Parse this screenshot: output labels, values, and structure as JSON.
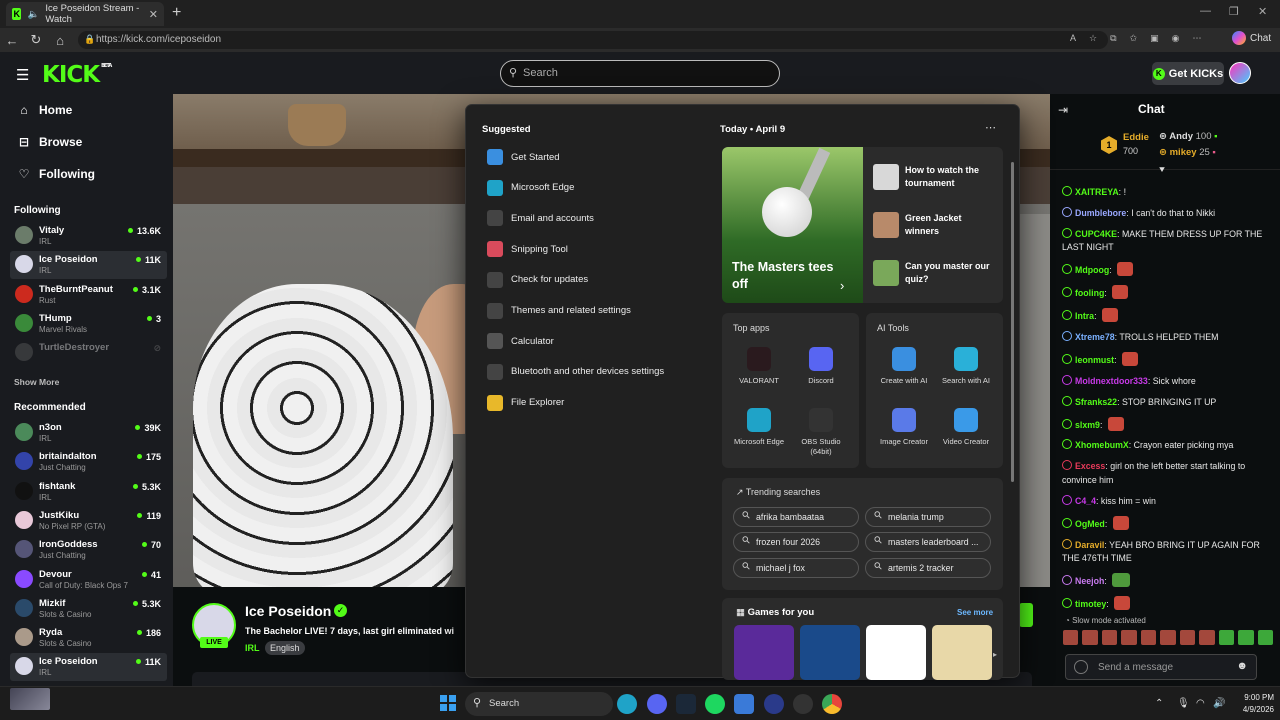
{
  "browser": {
    "tab_title": "Ice Poseidon Stream - Watch",
    "url": "https://kick.com/iceposeidon",
    "chat_label": "Chat"
  },
  "header": {
    "logo": "KICK",
    "logo_sup": "BETA",
    "search_placeholder": "Search",
    "get_kicks": "Get KICKs"
  },
  "sidebar": {
    "nav": [
      {
        "label": "Home",
        "icon": "home-icon"
      },
      {
        "label": "Browse",
        "icon": "browse-icon"
      },
      {
        "label": "Following",
        "icon": "heart-icon"
      }
    ],
    "following_title": "Following",
    "following": [
      {
        "name": "Vitaly",
        "category": "IRL",
        "viewers": "13.6K",
        "color": "#6b7c6a"
      },
      {
        "name": "Ice Poseidon",
        "category": "IRL",
        "viewers": "11K",
        "color": "#d8d8e8"
      },
      {
        "name": "TheBurntPeanut",
        "category": "Rust",
        "viewers": "3.1K",
        "color": "#cc2a1e"
      },
      {
        "name": "THump",
        "category": "Marvel Rivals",
        "viewers": "3",
        "color": "#3a8a3a"
      },
      {
        "name": "TurtleDestroyer",
        "category": "",
        "viewers": "",
        "color": "#666"
      }
    ],
    "show_more": "Show More",
    "recommended_title": "Recommended",
    "recommended": [
      {
        "name": "n3on",
        "category": "IRL",
        "viewers": "39K",
        "color": "#4b8a5a"
      },
      {
        "name": "britaindalton",
        "category": "Just Chatting",
        "viewers": "175",
        "color": "#3344aa"
      },
      {
        "name": "fishtank",
        "category": "IRL",
        "viewers": "5.3K",
        "color": "#111"
      },
      {
        "name": "JustKiku",
        "category": "No Pixel RP (GTA)",
        "viewers": "119",
        "color": "#e8c8d8"
      },
      {
        "name": "IronGoddess",
        "category": "Just Chatting",
        "viewers": "70",
        "color": "#555577"
      },
      {
        "name": "Devour",
        "category": "Call of Duty: Black Ops 7",
        "viewers": "41",
        "color": "#8a4aff"
      },
      {
        "name": "Mizkif",
        "category": "Slots & Casino",
        "viewers": "5.3K",
        "color": "#2a4a6a"
      },
      {
        "name": "Ryda",
        "category": "Slots & Casino",
        "viewers": "186",
        "color": "#aa9a8a"
      },
      {
        "name": "Ice Poseidon",
        "category": "IRL",
        "viewers": "11K",
        "color": "#d8d8e8"
      }
    ]
  },
  "stream": {
    "name": "Ice Poseidon",
    "live": "LIVE",
    "title": "The Bachelor LIVE! 7 days, last girl eliminated wi",
    "category": "IRL",
    "language": "English"
  },
  "start_menu": {
    "suggested_title": "Suggested",
    "suggested": [
      {
        "label": "Get Started",
        "icon": "get-started-icon",
        "color": "#3a8fe0"
      },
      {
        "label": "Microsoft Edge",
        "icon": "edge-icon",
        "color": "#1fa3c8"
      },
      {
        "label": "Email and accounts",
        "icon": "mail-icon",
        "color": "#444"
      },
      {
        "label": "Snipping Tool",
        "icon": "snipping-tool-icon",
        "color": "#d94b5c"
      },
      {
        "label": "Check for updates",
        "icon": "refresh-icon",
        "color": "#444"
      },
      {
        "label": "Themes and related settings",
        "icon": "brush-icon",
        "color": "#444"
      },
      {
        "label": "Calculator",
        "icon": "calculator-icon",
        "color": "#555"
      },
      {
        "label": "Bluetooth and other devices settings",
        "icon": "devices-icon",
        "color": "#444"
      },
      {
        "label": "File Explorer",
        "icon": "folder-icon",
        "color": "#e8b82a"
      }
    ],
    "today": "Today",
    "date": "April 9",
    "hero_title": "The Masters tees off",
    "news": [
      {
        "title": "How to watch the tournament",
        "color": "#d8d8d8"
      },
      {
        "title": "Green Jacket winners",
        "color": "#b88a6a"
      },
      {
        "title": "Can you master our quiz?",
        "color": "#7aa85a"
      }
    ],
    "top_apps_title": "Top apps",
    "top_apps": [
      {
        "label": "VALORANT",
        "icon": "valorant-icon",
        "color": "#2a1a1e"
      },
      {
        "label": "Discord",
        "icon": "discord-icon",
        "color": "#5865f2"
      },
      {
        "label": "Microsoft Edge",
        "icon": "edge-icon",
        "color": "#1fa3c8"
      },
      {
        "label": "OBS Studio (64bit)",
        "icon": "obs-icon",
        "color": "#333"
      }
    ],
    "ai_tools_title": "AI Tools",
    "ai_tools": [
      {
        "label": "Create with AI",
        "icon": "create-ai-icon",
        "color": "#3a8fe0"
      },
      {
        "label": "Search with AI",
        "icon": "search-ai-icon",
        "color": "#2ab0d8"
      },
      {
        "label": "Image Creator",
        "icon": "image-creator-icon",
        "color": "#5a7ae8"
      },
      {
        "label": "Video Creator",
        "icon": "video-creator-icon",
        "color": "#3a9ae8"
      }
    ],
    "trending_title": "Trending searches",
    "trending": [
      "afrika bambaataa",
      "melania trump",
      "frozen four 2026",
      "masters leaderboard ...",
      "michael j fox",
      "artemis 2 tracker"
    ],
    "games_title": "Games for you",
    "see_more": "See more",
    "games": [
      {
        "name": "arrow-game",
        "color": "#5a2a9a"
      },
      {
        "name": "drive-quest",
        "color": "#1a4a8a"
      },
      {
        "name": "cut-the-rope",
        "color": "#ffffff"
      },
      {
        "name": "cat-puzzle",
        "color": "#e8d8a8"
      }
    ]
  },
  "chat": {
    "title": "Chat",
    "leaderboard": [
      {
        "name": "Eddie",
        "amount": "700",
        "color": "#e5ac2a"
      },
      {
        "name": "Andy",
        "amount": "100",
        "color": "#dddddd"
      },
      {
        "name": "mikey",
        "amount": "25",
        "color": "#e5ac2a"
      }
    ],
    "messages": [
      {
        "user": "XAITREYA",
        "text": "!",
        "color": "#53fc18"
      },
      {
        "user": "Dumblebore",
        "text": "I can't do that to Nikki",
        "color": "#9aa8ff"
      },
      {
        "user": "CUPC4KE",
        "text": "MAKE THEM DRESS UP FOR THE LAST NIGHT",
        "color": "#53fc18"
      },
      {
        "user": "Mdpoog",
        "text": "",
        "color": "#53fc18"
      },
      {
        "user": "fooling",
        "text": "",
        "color": "#53fc18"
      },
      {
        "user": "Intra",
        "text": "",
        "color": "#53fc18"
      },
      {
        "user": "Xtreme78",
        "text": "TROLLS HELPED THEM",
        "color": "#7ab0ff"
      },
      {
        "user": "leonmust",
        "text": "",
        "color": "#53fc18"
      },
      {
        "user": "Moldnextdoor333",
        "text": "Sick whore",
        "color": "#c83ae8"
      },
      {
        "user": "Sfranks22",
        "text": "STOP BRINGING IT UP",
        "color": "#53fc18"
      },
      {
        "user": "slxm9",
        "text": "",
        "color": "#53fc18"
      },
      {
        "user": "XhomebumX",
        "text": "Crayon eater picking mya",
        "color": "#53fc18"
      },
      {
        "user": "Excess",
        "text": "girl on the left better start talking to convince him",
        "color": "#e83a5a"
      },
      {
        "user": "C4_4",
        "text": "kiss him = win",
        "color": "#c83ae8"
      },
      {
        "user": "OgMed",
        "text": "",
        "color": "#53fc18"
      },
      {
        "user": "Daravil",
        "text": "YEAH BRO BRING IT UP AGAIN FOR THE 476TH TIME",
        "color": "#e5ac2a"
      },
      {
        "user": "Neejoh",
        "text": "",
        "color": "#c87af0"
      },
      {
        "user": "timotey",
        "text": "",
        "color": "#53fc18"
      }
    ],
    "slow_mode": "Slow mode activated",
    "input_placeholder": "Send a message"
  },
  "taskbar": {
    "search": "Search",
    "time": "9:00 PM",
    "date": "4/9/2026"
  }
}
